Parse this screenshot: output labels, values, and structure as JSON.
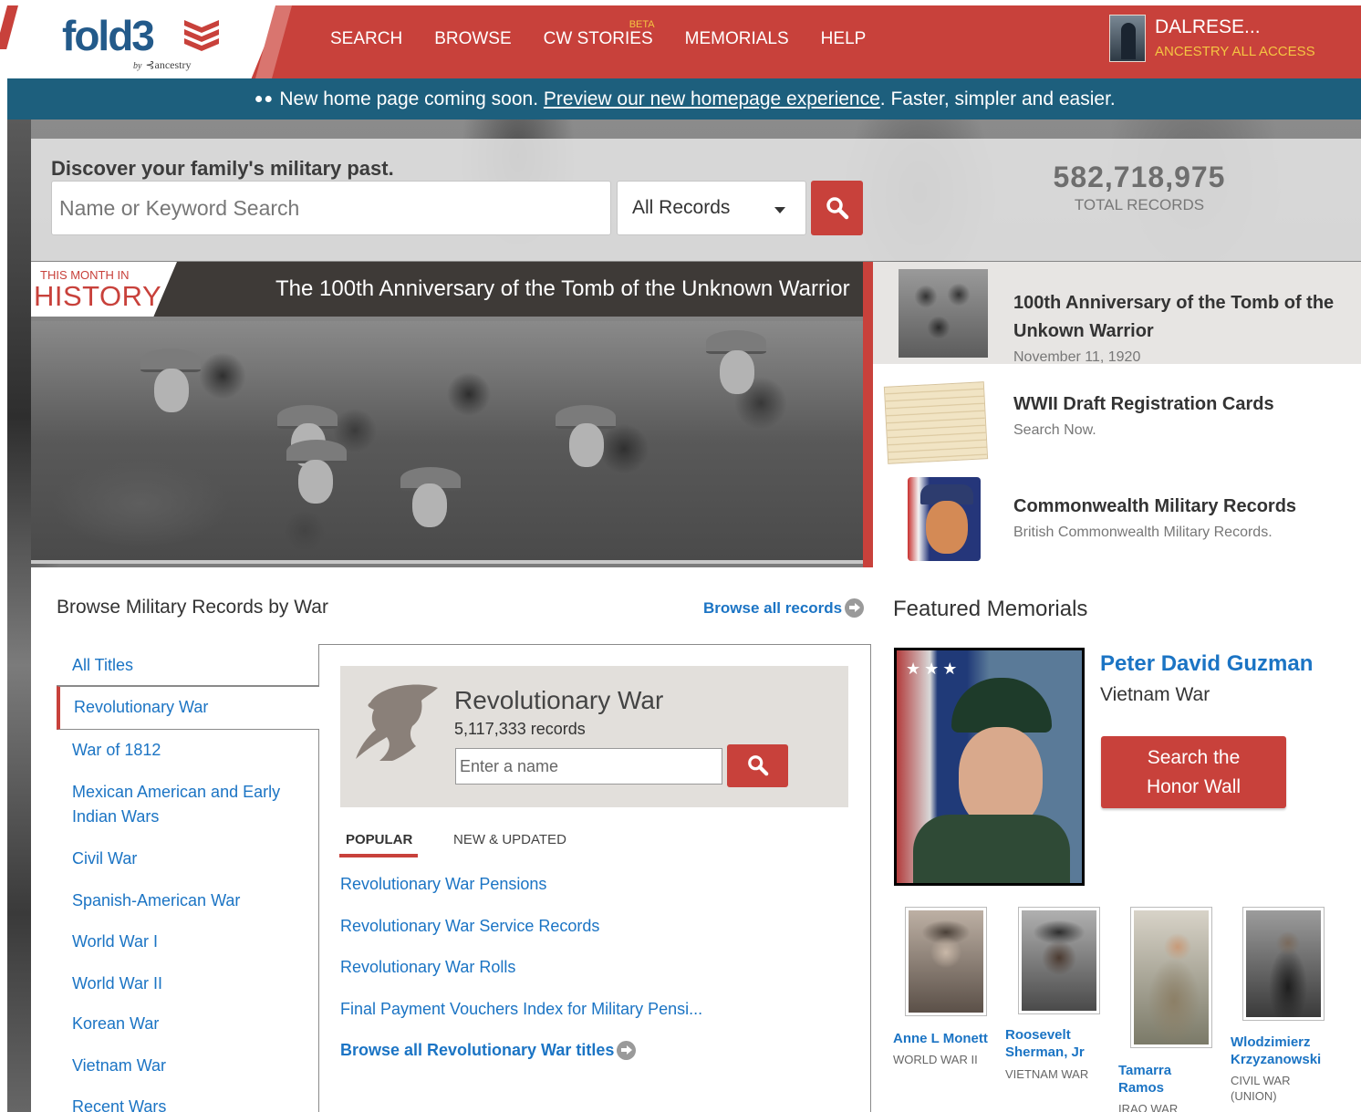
{
  "header": {
    "logo_text": "fold3",
    "logo_by": "by",
    "logo_sub": "ancestry",
    "nav": [
      {
        "label": "SEARCH"
      },
      {
        "label": "BROWSE"
      },
      {
        "label": "CW STORIES",
        "badge": "BETA"
      },
      {
        "label": "MEMORIALS"
      },
      {
        "label": "HELP"
      }
    ],
    "user_name": "DALRESE...",
    "user_plan": "ANCESTRY ALL ACCESS"
  },
  "announcement": {
    "lead": "New home page coming soon.",
    "link": "Preview our new homepage experience",
    "tail": ". Faster, simpler and easier."
  },
  "search": {
    "title": "Discover your family's military past.",
    "placeholder": "Name or Keyword Search",
    "scope": "All Records",
    "total_records": "582,718,975",
    "total_label": "TOTAL RECORDS"
  },
  "history": {
    "tag_small": "THIS MONTH IN",
    "tag_big": "HISTORY",
    "title": "The 100th Anniversary of the Tomb of the Unknown Warrior"
  },
  "features": [
    {
      "title": "100th Anniversary of the Tomb of the Unkown Warrior",
      "sub": "November 11, 1920"
    },
    {
      "title": "WWII Draft Registration Cards",
      "sub": "Search Now."
    },
    {
      "title": "Commonwealth Military Records",
      "sub": "British Commonwealth Military Records."
    }
  ],
  "browse": {
    "title": "Browse Military Records by War",
    "browse_all": "Browse all records",
    "wars": [
      "All Titles",
      "Revolutionary War",
      "War of 1812",
      "Mexican American and Early Indian Wars",
      "Civil War",
      "Spanish-American War",
      "World War I",
      "World War II",
      "Korean War",
      "Vietnam War",
      "Recent Wars"
    ],
    "selected": {
      "title": "Revolutionary War",
      "count": "5,117,333 records",
      "placeholder": "Enter a name"
    },
    "tabs": [
      "POPULAR",
      "NEW & UPDATED"
    ],
    "popular": [
      "Revolutionary War Pensions",
      "Revolutionary War Service Records",
      "Revolutionary War Rolls",
      "Final Payment Vouchers Index for Military Pensi..."
    ],
    "browse_titles": "Browse all Revolutionary War titles"
  },
  "memorials": {
    "title": "Featured Memorials",
    "featured_name": "Peter David Guzman",
    "featured_war": "Vietnam War",
    "honor_button": "Search the Honor Wall",
    "people": [
      {
        "name": "Anne L Monett",
        "war": "WORLD WAR II"
      },
      {
        "name": "Roosevelt Sherman, Jr",
        "war": "VIETNAM WAR"
      },
      {
        "name": "Tamarra Ramos",
        "war": "IRAQ WAR"
      },
      {
        "name": "Wlodzimierz Krzyzanowski",
        "war": "CIVIL WAR (UNION)"
      }
    ]
  },
  "colors": {
    "brand_red": "#c8413b",
    "brand_blue": "#235a8a",
    "banner_teal": "#1d5f7d",
    "link_blue": "#1b74c4",
    "plan_gold": "#f4c542"
  },
  "icons": [
    "search-icon",
    "caret-down-icon",
    "arrow-circle-icon",
    "eyes-icon",
    "fold3-chevrons-icon",
    "ancestry-leaf-icon"
  ]
}
